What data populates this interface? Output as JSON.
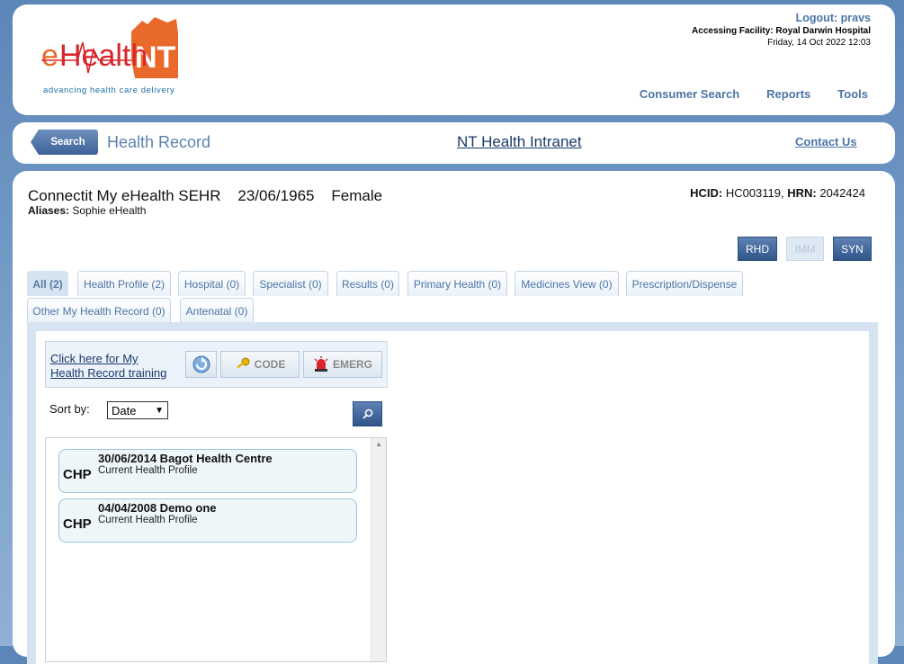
{
  "header": {
    "logo_main": "eHealth",
    "logo_accent": "NT",
    "logo_tagline": "advancing health care delivery",
    "logout_label": "Logout:",
    "logout_user": "pravs",
    "facility_label": "Accessing Facility:",
    "facility_value": "Royal Darwin Hospital",
    "datetime": "Friday, 14 Oct 2022 12:03",
    "nav": [
      "Consumer Search",
      "Reports",
      "Tools"
    ]
  },
  "navbar": {
    "search_label": "Search",
    "title": "Health Record",
    "intranet_link": "NT Health Intranet",
    "contact_link": "Contact Us"
  },
  "patient": {
    "name": "Connectit My eHealth SEHR",
    "dob": "23/06/1965",
    "sex": "Female",
    "aliases_label": "Aliases:",
    "aliases_value": "Sophie eHealth",
    "hcid_label": "HCID:",
    "hcid_value": "HC003119",
    "hrn_label": "HRN:",
    "hrn_value": "2042424"
  },
  "action_buttons": [
    {
      "label": "RHD",
      "enabled": true
    },
    {
      "label": "IMM",
      "enabled": false
    },
    {
      "label": "SYN",
      "enabled": true
    }
  ],
  "tabs": [
    "All (2)",
    "Health Profile (2)",
    "Hospital (0)",
    "Specialist (0)",
    "Results (0)",
    "Primary Health (0)",
    "Medicines View (0)",
    "Prescription/Dispense",
    "Other My Health Record (0)",
    "Antenatal (0)"
  ],
  "tools": {
    "training_line1": "Click here for My",
    "training_line2": "Health Record training",
    "code_label": "CODE",
    "emerg_label": "EMERG"
  },
  "sort": {
    "label": "Sort by:",
    "selected": "Date"
  },
  "records": [
    {
      "tag": "CHP",
      "title": "30/06/2014 Bagot Health Centre",
      "subtitle": "Current Health Profile"
    },
    {
      "tag": "CHP",
      "title": "04/04/2008 Demo one",
      "subtitle": "Current Health Profile"
    }
  ],
  "colors": {
    "accent_blue": "#4b74a6",
    "logo_orange": "#e8692a",
    "logo_red": "#d9262b",
    "button_dark": "#2f5589"
  }
}
